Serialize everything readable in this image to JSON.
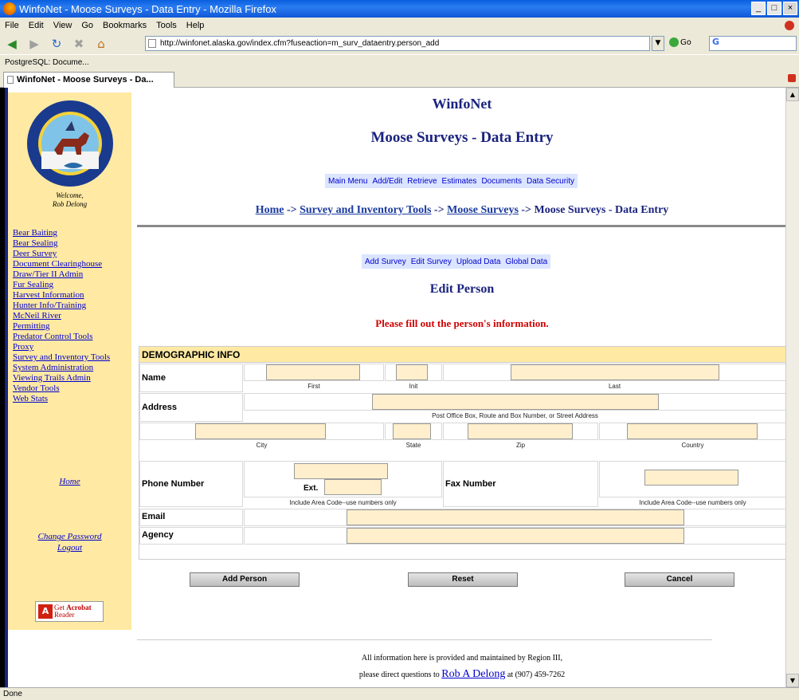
{
  "window": {
    "title": "WinfoNet - Moose Surveys - Data Entry - Mozilla Firefox",
    "min": "_",
    "max": "□",
    "close": "×"
  },
  "menu": [
    "File",
    "Edit",
    "View",
    "Go",
    "Bookmarks",
    "Tools",
    "Help"
  ],
  "nav": {
    "url": "http://winfonet.alaska.gov/index.cfm?fuseaction=m_surv_dataentry.person_add",
    "go_label": "Go",
    "search_value": "G"
  },
  "bookmarks": [
    "PostgreSQL: Docume..."
  ],
  "tabs": [
    {
      "label": "WinfoNet - Moose Surveys - Da..."
    }
  ],
  "sidebar": {
    "welcome": "Welcome,",
    "user": "Rob Delong",
    "links": [
      "Bear Baiting",
      "Bear Sealing",
      "Deer Survey",
      "Document Clearinghouse",
      "Draw/Tier II Admin",
      "Fur Sealing",
      "Harvest Information",
      "Hunter Info/Training",
      "McNeil River",
      "Permitting",
      "Predator Control Tools",
      "Proxy",
      "Survey and Inventory Tools",
      "System Administration",
      "Viewing Trails Admin",
      "Vendor Tools",
      "Web Stats"
    ],
    "home": "Home",
    "change_password": "Change Password",
    "logout": "Logout",
    "acrobat_get": "Get",
    "acrobat_name": "Acrobat",
    "acrobat_reader": "Reader"
  },
  "header": {
    "site": "WinfoNet",
    "app": "Moose Surveys - Data Entry",
    "menu": [
      "Main Menu",
      "Add/Edit",
      "Retrieve",
      "Estimates",
      "Documents",
      "Data Security"
    ]
  },
  "breadcrumb": {
    "items": [
      "Home",
      "Survey and Inventory Tools",
      "Moose Surveys"
    ],
    "sep": "->",
    "current": "Moose Surveys - Data Entry"
  },
  "submenu": [
    "Add Survey",
    "Edit Survey",
    "Upload Data",
    "Global Data"
  ],
  "form": {
    "title": "Edit Person",
    "message": "Please fill out the person's information.",
    "section": "DEMOGRAPHIC INFO",
    "name_label": "Name",
    "first_caption": "First",
    "init_caption": "Init",
    "last_caption": "Last",
    "address_label": "Address",
    "address_caption": "Post Office Box, Route and Box Number, or Street Address",
    "city_caption": "City",
    "state_caption": "State",
    "zip_caption": "Zip",
    "country_caption": "Country",
    "phone_label": "Phone Number",
    "ext_label": "Ext.",
    "phone_caption": "Include Area Code--use numbers only",
    "fax_label": "Fax Number",
    "fax_caption": "Include Area Code--use numbers only",
    "email_label": "Email",
    "agency_label": "Agency"
  },
  "buttons": {
    "add": "Add Person",
    "reset": "Reset",
    "cancel": "Cancel"
  },
  "footer": {
    "line1": "All information here is provided and maintained by Region III,",
    "line2a": "please direct questions to",
    "contact": "Rob A Delong",
    "line2b": "at (907) 459-7262"
  },
  "status": "Done",
  "colors": {
    "sidebar": "#ffe9a3",
    "input": "#ffefcc",
    "heading": "#1a237e",
    "message": "#d00000",
    "menu_bg": "#dbe5ff"
  }
}
